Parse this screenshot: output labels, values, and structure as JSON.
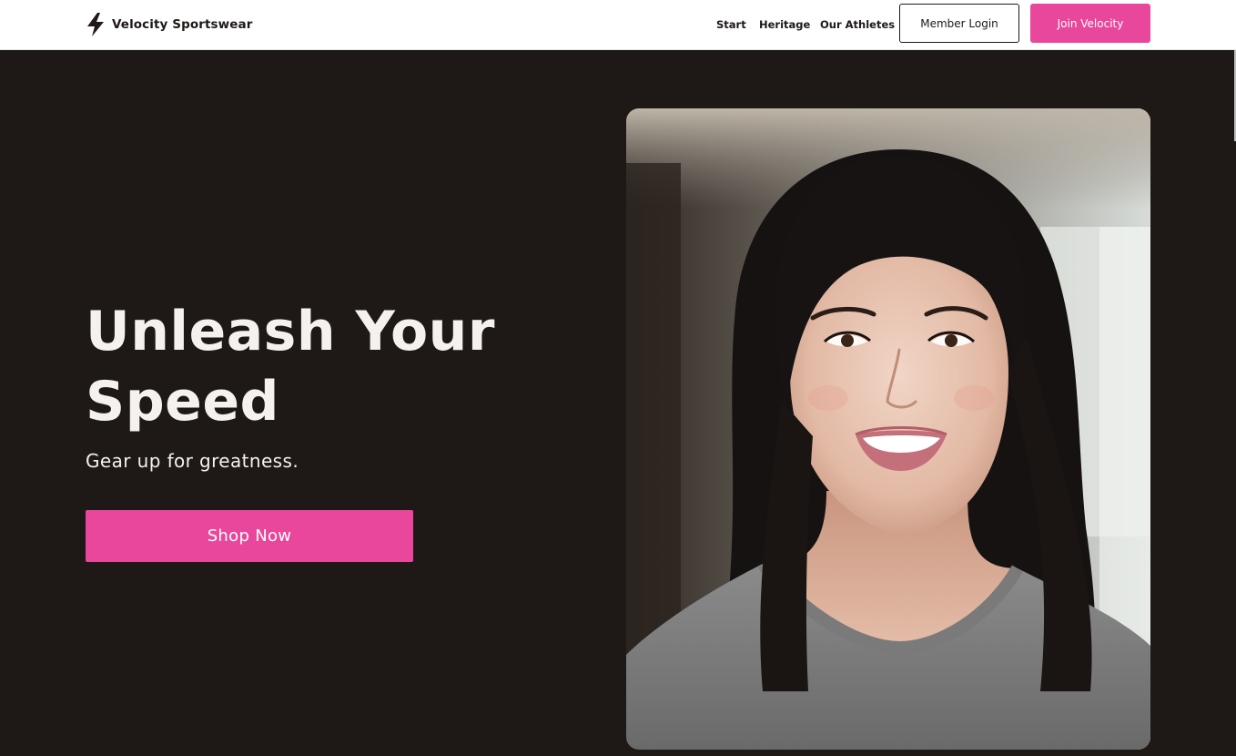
{
  "header": {
    "brand_name": "Velocity Sportswear",
    "brand_icon": "lightning-bolt-icon",
    "nav": [
      {
        "label": "Start"
      },
      {
        "label": "Heritage"
      },
      {
        "label": "Our Athletes"
      }
    ],
    "login_label": "Member Login",
    "join_label": "Join Velocity"
  },
  "hero": {
    "title_line1": "Unleash Your",
    "title_line2": "Speed",
    "subtitle": "Gear up for greatness.",
    "cta_label": "Shop Now"
  },
  "colors": {
    "accent": "#e9479b",
    "background": "#1e1917",
    "header_bg": "#ffffff",
    "text_light": "#f4f1ee",
    "text_dark": "#1e1917"
  }
}
